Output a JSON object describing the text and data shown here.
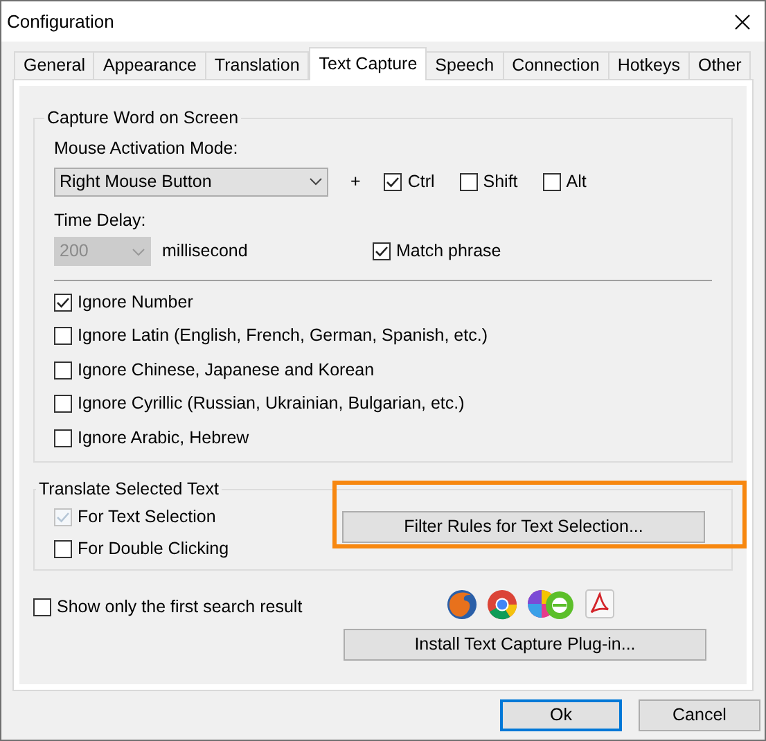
{
  "window": {
    "title": "Configuration"
  },
  "tabs": [
    {
      "label": "General",
      "selected": false
    },
    {
      "label": "Appearance",
      "selected": false
    },
    {
      "label": "Translation",
      "selected": false
    },
    {
      "label": "Text Capture",
      "selected": true
    },
    {
      "label": "Speech",
      "selected": false
    },
    {
      "label": "Connection",
      "selected": false
    },
    {
      "label": "Hotkeys",
      "selected": false
    },
    {
      "label": "Other",
      "selected": false
    }
  ],
  "capture_group": {
    "title": "Capture Word on Screen",
    "mouse_mode_label": "Mouse Activation Mode:",
    "mouse_mode": {
      "value": "Right Mouse Button"
    },
    "plus": "+",
    "modifiers": [
      {
        "label": "Ctrl",
        "checked": true
      },
      {
        "label": "Shift",
        "checked": false
      },
      {
        "label": "Alt",
        "checked": false
      }
    ],
    "time_delay_label": "Time Delay:",
    "time_delay": {
      "value": "200",
      "disabled": true
    },
    "unit": "millisecond",
    "match_phrase": {
      "label": "Match phrase",
      "checked": true
    },
    "ignore_options": [
      {
        "label": "Ignore Number",
        "checked": true
      },
      {
        "label": "Ignore Latin (English, French, German, Spanish, etc.)",
        "checked": false
      },
      {
        "label": "Ignore Chinese, Japanese and Korean",
        "checked": false
      },
      {
        "label": "Ignore Cyrillic (Russian, Ukrainian, Bulgarian, etc.)",
        "checked": false
      },
      {
        "label": "Ignore Arabic, Hebrew",
        "checked": false
      }
    ]
  },
  "translate_group": {
    "title": "Translate Selected Text",
    "options": [
      {
        "label": "For Text Selection",
        "checked": true,
        "disabled": true
      },
      {
        "label": "For Double Clicking",
        "checked": false,
        "disabled": false
      }
    ],
    "filter_button": "Filter Rules for Text Selection..."
  },
  "show_first": {
    "label": "Show only the first search result",
    "checked": false
  },
  "install_button": "Install Text Capture Plug-in...",
  "buttons": [
    {
      "label": "Ok",
      "default": true
    },
    {
      "label": "Cancel",
      "default": false
    }
  ]
}
